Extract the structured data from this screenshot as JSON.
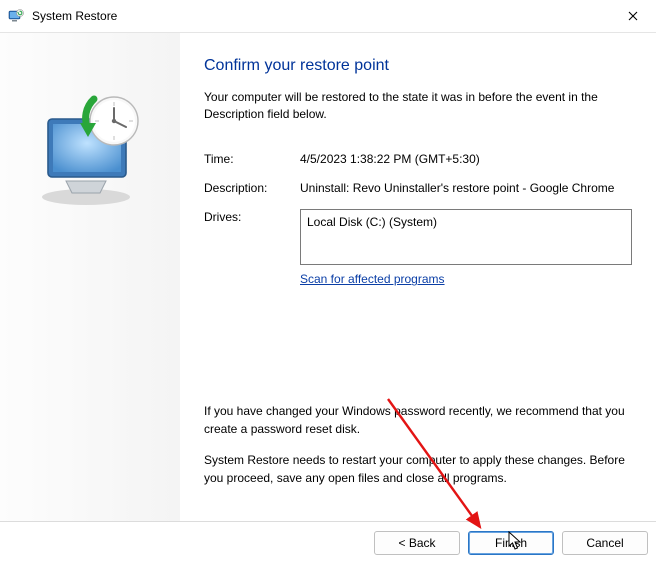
{
  "window": {
    "title": "System Restore"
  },
  "header": {
    "title": "Confirm your restore point",
    "intro": "Your computer will be restored to the state it was in before the event in the Description field below."
  },
  "fields": {
    "time_label": "Time:",
    "time_value": "4/5/2023 1:38:22 PM (GMT+5:30)",
    "description_label": "Description:",
    "description_value": "Uninstall: Revo Uninstaller's restore point - Google Chrome",
    "drives_label": "Drives:",
    "drives": [
      "Local Disk (C:) (System)"
    ],
    "scan_link": "Scan for affected programs"
  },
  "notes": {
    "password_note": "If you have changed your Windows password recently, we recommend that you create a password reset disk.",
    "restart_note": "System Restore needs to restart your computer to apply these changes. Before you proceed, save any open files and close all programs."
  },
  "buttons": {
    "back": "< Back",
    "finish": "Finish",
    "cancel": "Cancel"
  }
}
